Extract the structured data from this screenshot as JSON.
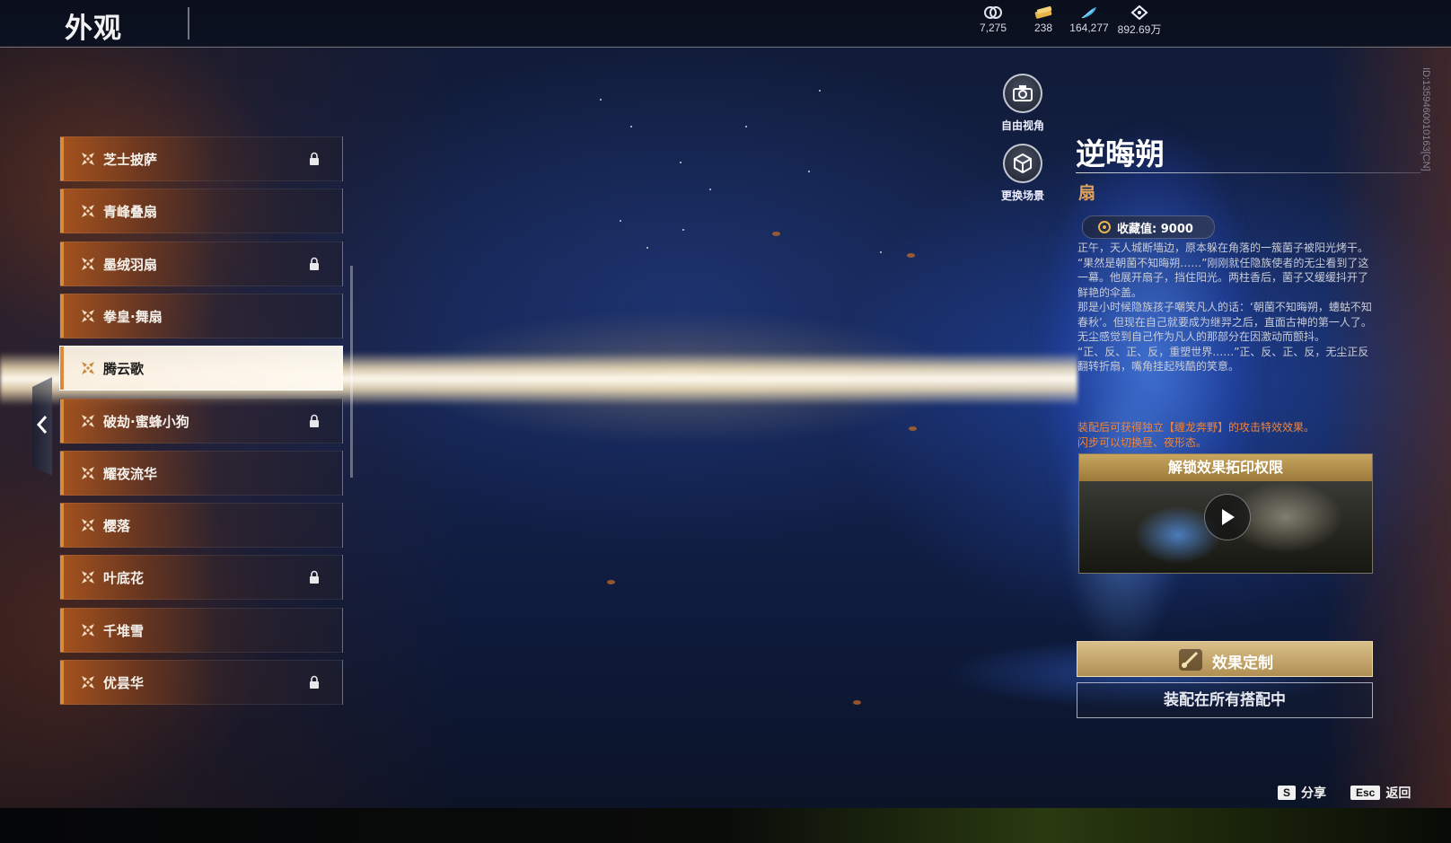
{
  "header": {
    "title": "外观",
    "currencies": [
      {
        "icon": "silver-coin-icon",
        "value": "7,275"
      },
      {
        "icon": "gold-ticket-icon",
        "value": "238"
      },
      {
        "icon": "feather-icon",
        "value": "164,277"
      },
      {
        "icon": "diamond-icon",
        "value": "892.69万"
      }
    ],
    "id_text": "ID:1359460010163[CN]"
  },
  "camera": {
    "free_view_label": "自由视角",
    "change_scene_label": "更换场景"
  },
  "list": {
    "items": [
      {
        "label": "芝士披萨",
        "locked": true,
        "selected": false
      },
      {
        "label": "青峰叠扇",
        "locked": false,
        "selected": false
      },
      {
        "label": "墨绒羽扇",
        "locked": true,
        "selected": false
      },
      {
        "label": "拳皇·舞扇",
        "locked": false,
        "selected": false
      },
      {
        "label": "腾云歌",
        "locked": false,
        "selected": true
      },
      {
        "label": "破劫·蜜蜂小狗",
        "locked": true,
        "selected": false
      },
      {
        "label": "耀夜流华",
        "locked": false,
        "selected": false
      },
      {
        "label": "樱落",
        "locked": false,
        "selected": false
      },
      {
        "label": "叶底花",
        "locked": true,
        "selected": false
      },
      {
        "label": "千堆雪",
        "locked": false,
        "selected": false
      },
      {
        "label": "优昙华",
        "locked": true,
        "selected": false
      }
    ]
  },
  "detail": {
    "name": "逆晦朔",
    "type": "扇",
    "collect_value": "收藏值: 9000",
    "description": [
      "正午，天人城断墙边，原本躲在角落的一簇菌子被阳光烤干。",
      "“果然是朝菌不知晦朔……”刚刚就任隐族使者的无尘看到了这一幕。他展开扇子，挡住阳光。两柱香后，菌子又缓缓抖开了鲜艳的伞盖。",
      "那是小时候隐族孩子嘲笑凡人的话：‘朝菌不知晦朔，蟪蛄不知春秋’。但现在自己就要成为继羿之后，直面古神的第一人了。无尘感觉到自己作为凡人的那部分在因激动而颤抖。",
      "“正、反、正、反，重塑世界……”正、反、正、反，无尘正反翻转折扇，嘴角挂起残酷的笑意。"
    ],
    "effect_note": [
      "装配后可获得独立【缠龙奔野】的攻击特效效果。",
      "闪步可以切换昼、夜形态。"
    ],
    "unlock_title": "解锁效果拓印权限",
    "custom_button": "效果定制",
    "equip_button": "装配在所有搭配中"
  },
  "hotkeys": [
    {
      "key": "S",
      "label": "分享"
    },
    {
      "key": "Esc",
      "label": "返回"
    }
  ],
  "colors": {
    "accent_orange": "#d98a3a",
    "gold_button": "#c8a65e",
    "effect_text": "#f0853a",
    "type_text": "#e0a25a"
  }
}
